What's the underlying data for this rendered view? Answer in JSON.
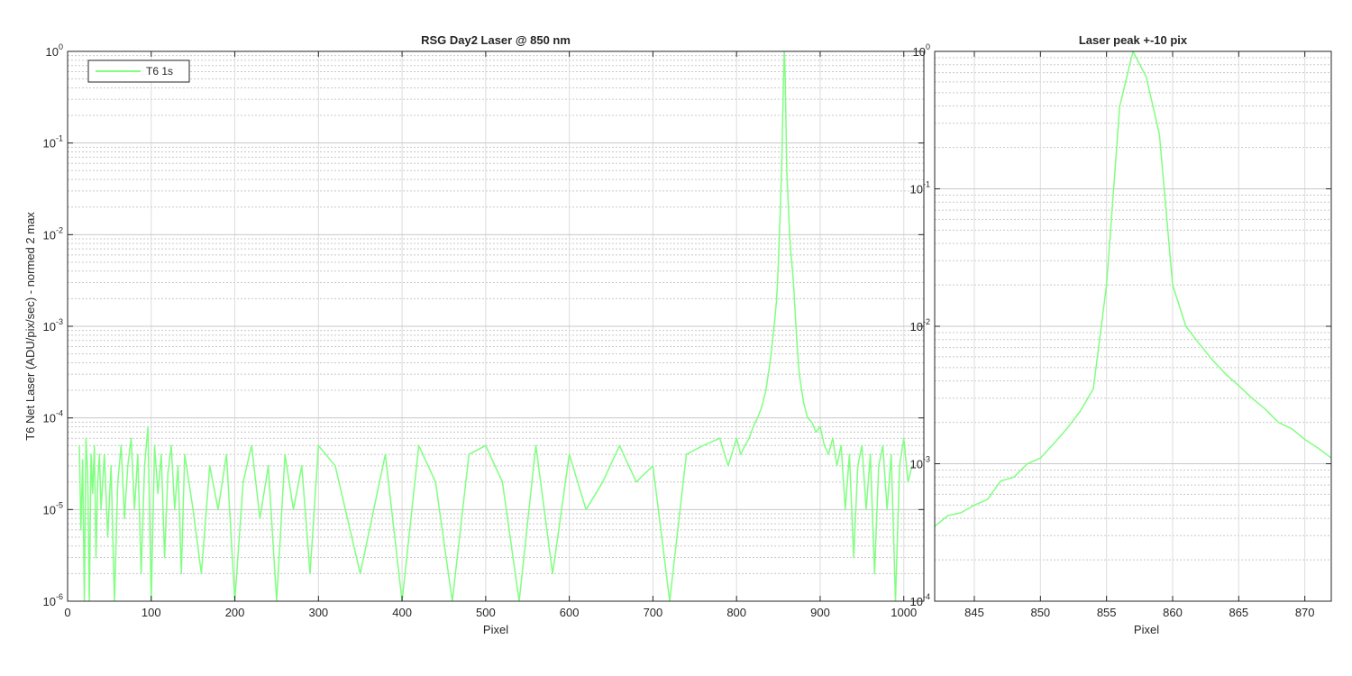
{
  "chart_data": [
    {
      "type": "line",
      "title": "RSG  Day2 Laser @ 850 nm",
      "xlabel": "Pixel",
      "ylabel": "T6 Net Laser (ADU/pix/sec) - normed 2 max",
      "xlim": [
        0,
        1024
      ],
      "ylim": [
        1e-06,
        1
      ],
      "yscale": "log",
      "grid": true,
      "minor_grid": true,
      "legend": "top-left",
      "x_ticks": [
        "0",
        "100",
        "200",
        "300",
        "400",
        "500",
        "600",
        "700",
        "800",
        "900",
        "1000"
      ],
      "y_ticks": [
        "10^-6",
        "10^-5",
        "10^-4",
        "10^-3",
        "10^-2",
        "10^-1",
        "10^0"
      ],
      "series": [
        {
          "name": "T6 1s",
          "color": "#80ff80",
          "x": [
            14,
            16,
            18,
            20,
            22,
            24,
            26,
            28,
            30,
            32,
            34,
            36,
            38,
            40,
            44,
            48,
            52,
            56,
            60,
            64,
            68,
            72,
            76,
            80,
            84,
            88,
            92,
            96,
            100,
            104,
            108,
            112,
            116,
            120,
            124,
            128,
            132,
            136,
            140,
            150,
            160,
            170,
            180,
            190,
            200,
            210,
            220,
            230,
            240,
            250,
            260,
            270,
            280,
            290,
            300,
            320,
            350,
            380,
            400,
            420,
            440,
            460,
            480,
            500,
            520,
            540,
            560,
            580,
            600,
            620,
            640,
            660,
            680,
            700,
            720,
            740,
            760,
            780,
            790,
            800,
            805,
            810,
            815,
            820,
            825,
            830,
            835,
            840,
            845,
            848,
            850,
            852,
            854,
            856,
            857,
            858,
            859,
            860,
            862,
            864,
            866,
            868,
            870,
            872,
            875,
            880,
            885,
            890,
            895,
            900,
            905,
            910,
            915,
            920,
            925,
            930,
            935,
            940,
            945,
            950,
            955,
            960,
            965,
            970,
            975,
            980,
            985,
            990,
            995,
            1000,
            1005,
            1010
          ],
          "y": [
            5e-05,
            6e-06,
            3.5e-05,
            1e-06,
            6e-05,
            2.5e-05,
            1e-06,
            4e-05,
            1.5e-05,
            5e-05,
            3e-06,
            2e-05,
            4e-05,
            1e-05,
            4e-05,
            5e-06,
            3e-05,
            1e-06,
            2e-05,
            5e-05,
            8e-06,
            3e-05,
            6e-05,
            1e-05,
            4e-05,
            2e-06,
            3e-05,
            8e-05,
            1e-06,
            5e-05,
            1.5e-05,
            4e-05,
            3e-06,
            2.5e-05,
            5e-05,
            1e-05,
            3e-05,
            2e-06,
            4e-05,
            1e-05,
            2e-06,
            3e-05,
            1e-05,
            4e-05,
            1e-06,
            2e-05,
            5e-05,
            8e-06,
            3e-05,
            1e-06,
            4e-05,
            1e-05,
            3e-05,
            2e-06,
            5e-05,
            3e-05,
            2e-06,
            4e-05,
            1e-06,
            5e-05,
            2e-05,
            1e-06,
            4e-05,
            5e-05,
            2e-05,
            1e-06,
            5e-05,
            2e-06,
            4e-05,
            1e-05,
            2e-05,
            5e-05,
            2e-05,
            3e-05,
            1e-06,
            4e-05,
            5e-05,
            6e-05,
            3e-05,
            6e-05,
            4e-05,
            5e-05,
            6e-05,
            8e-05,
            0.0001,
            0.00013,
            0.0002,
            0.0004,
            0.001,
            0.002,
            0.005,
            0.015,
            0.06,
            0.4,
            1.0,
            0.6,
            0.2,
            0.05,
            0.02,
            0.008,
            0.005,
            0.003,
            0.0015,
            0.0007,
            0.0003,
            0.00015,
            0.0001,
            9e-05,
            7e-05,
            8e-05,
            5e-05,
            4e-05,
            6e-05,
            3e-05,
            5e-05,
            1e-05,
            4e-05,
            3e-06,
            3e-05,
            5e-05,
            1e-05,
            4e-05,
            2e-06,
            3e-05,
            5e-05,
            1e-05,
            4e-05,
            1e-06,
            3e-05,
            6e-05,
            2e-05,
            3e-05
          ]
        }
      ]
    },
    {
      "type": "line",
      "title": "Laser peak +-10 pix",
      "xlabel": "Pixel",
      "xlim": [
        842,
        872
      ],
      "ylim": [
        0.0001,
        1
      ],
      "yscale": "log",
      "grid": true,
      "minor_grid": true,
      "x_ticks": [
        "845",
        "850",
        "855",
        "860",
        "865",
        "870"
      ],
      "y_ticks": [
        "10^-4",
        "10^-3",
        "10^-2",
        "10^-1",
        "10^0"
      ],
      "series": [
        {
          "color": "#80ff80",
          "x": [
            842,
            843,
            844,
            845,
            846,
            847,
            848,
            849,
            850,
            851,
            852,
            853,
            854,
            855,
            856,
            857,
            858,
            859,
            860,
            861,
            862,
            863,
            864,
            865,
            866,
            867,
            868,
            869,
            870,
            871,
            872
          ],
          "y": [
            0.00035,
            0.00042,
            0.00044,
            0.0005,
            0.00055,
            0.00075,
            0.0008,
            0.001,
            0.0011,
            0.0014,
            0.0018,
            0.0024,
            0.0035,
            0.02,
            0.4,
            1.0,
            0.65,
            0.25,
            0.02,
            0.01,
            0.0075,
            0.0057,
            0.0045,
            0.0037,
            0.003,
            0.0025,
            0.002,
            0.0018,
            0.0015,
            0.0013,
            0.0011
          ]
        }
      ]
    }
  ]
}
